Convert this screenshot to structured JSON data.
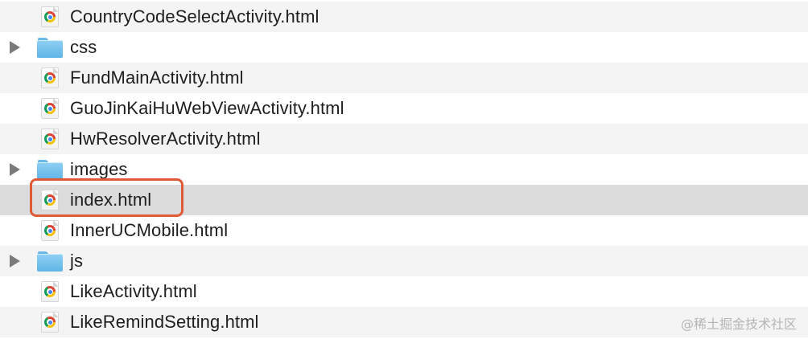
{
  "file_list": {
    "items": [
      {
        "name": "CountryCodeSelectActivity.html",
        "kind": "file",
        "icon": "chrome-html-file-icon"
      },
      {
        "name": "css",
        "kind": "folder",
        "icon": "folder-icon"
      },
      {
        "name": "FundMainActivity.html",
        "kind": "file",
        "icon": "chrome-html-file-icon"
      },
      {
        "name": "GuoJinKaiHuWebViewActivity.html",
        "kind": "file",
        "icon": "chrome-html-file-icon"
      },
      {
        "name": "HwResolverActivity.html",
        "kind": "file",
        "icon": "chrome-html-file-icon"
      },
      {
        "name": "images",
        "kind": "folder",
        "icon": "folder-icon"
      },
      {
        "name": "index.html",
        "kind": "file",
        "icon": "chrome-html-file-icon",
        "selected": true
      },
      {
        "name": "InnerUCMobile.html",
        "kind": "file",
        "icon": "chrome-html-file-icon"
      },
      {
        "name": "js",
        "kind": "folder",
        "icon": "folder-icon"
      },
      {
        "name": "LikeActivity.html",
        "kind": "file",
        "icon": "chrome-html-file-icon"
      },
      {
        "name": "LikeRemindSetting.html",
        "kind": "file",
        "icon": "chrome-html-file-icon"
      }
    ]
  },
  "annotation": {
    "color": "#e05a35"
  },
  "watermark": {
    "text": "@稀土掘金技术社区"
  }
}
